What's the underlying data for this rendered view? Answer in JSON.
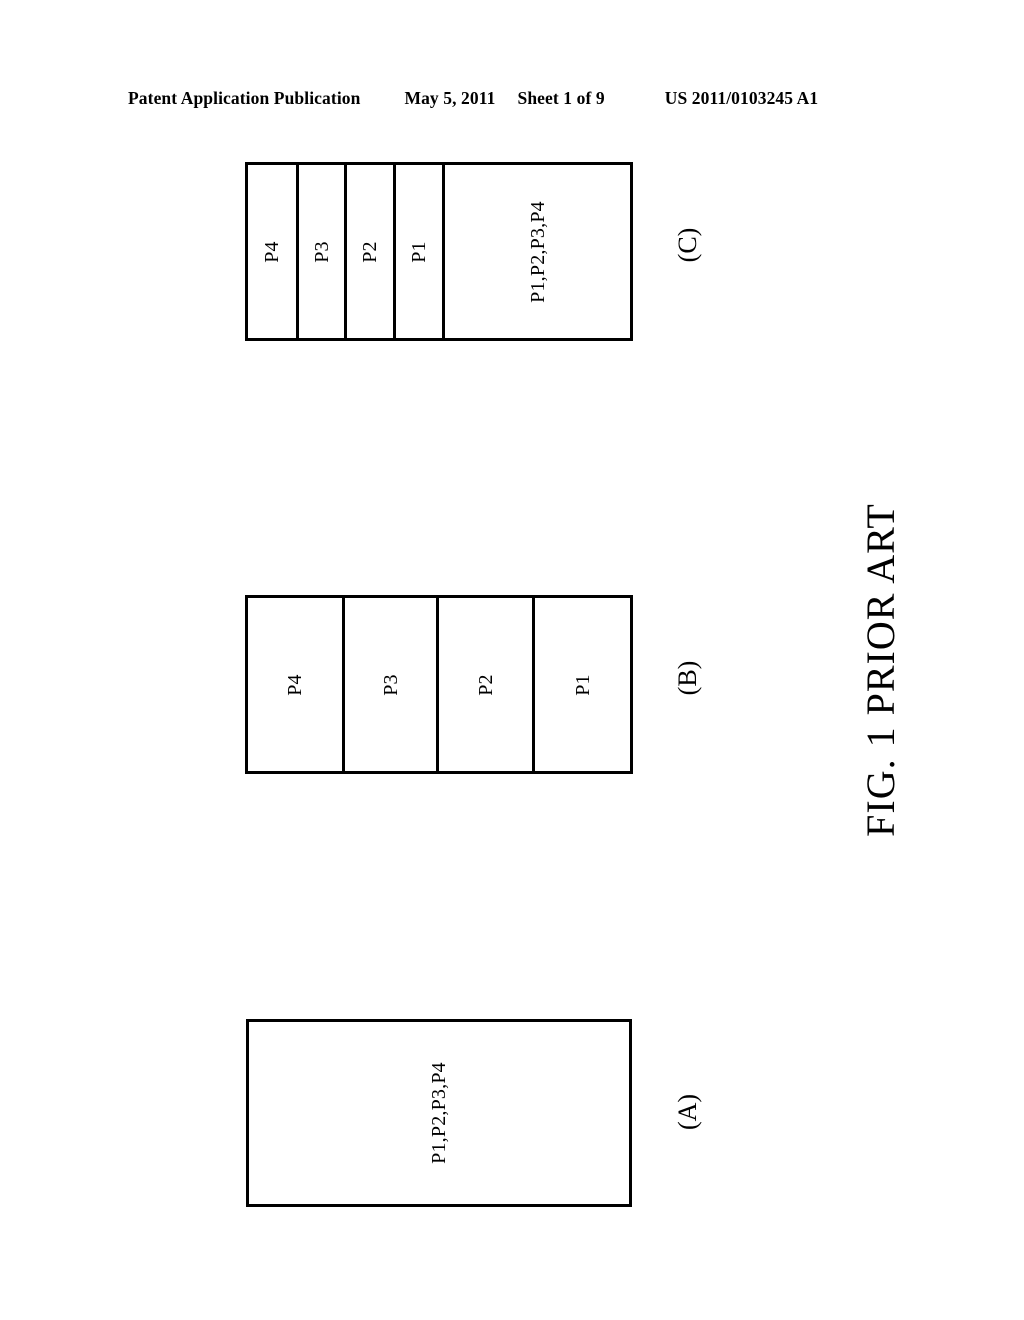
{
  "header": {
    "publication": "Patent Application Publication",
    "date": "May 5, 2011",
    "sheet": "Sheet 1 of 9",
    "patent_number": "US 2011/0103245 A1"
  },
  "caption": {
    "text": "FIG. 1 PRIOR ART"
  },
  "figures": [
    {
      "id": "figure-c",
      "letter": "(C)",
      "cells": [
        {
          "label": "P4"
        },
        {
          "label": "P3"
        },
        {
          "label": "P2"
        },
        {
          "label": "P1"
        },
        {
          "label": "P1,P2,P3,P4"
        }
      ]
    },
    {
      "id": "figure-b",
      "letter": "(B)",
      "cells": [
        {
          "label": "P4"
        },
        {
          "label": "P3"
        },
        {
          "label": "P2"
        },
        {
          "label": "P1"
        }
      ]
    },
    {
      "id": "figure-a",
      "letter": "(A)",
      "cells": [
        {
          "label": "P1,P2,P3,P4"
        }
      ]
    }
  ],
  "colors": {
    "ink": "#000000",
    "paper": "#ffffff"
  }
}
